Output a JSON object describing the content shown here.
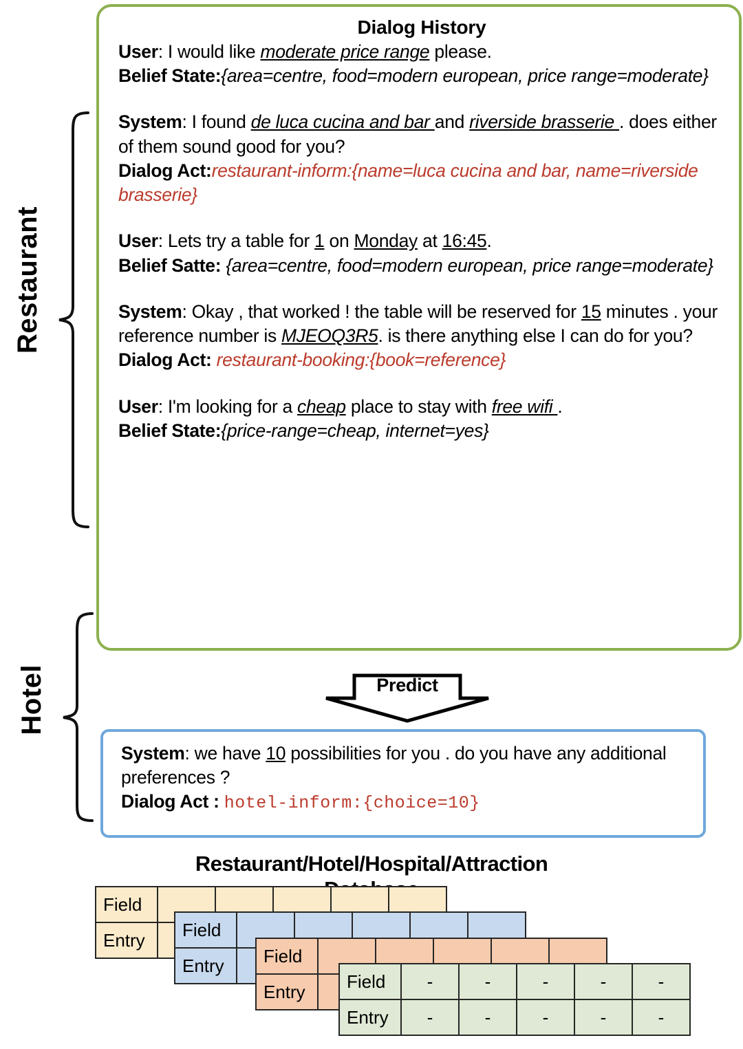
{
  "side_labels": {
    "restaurant": "Restaurant",
    "hotel": "Hotel"
  },
  "dialog_history": {
    "title": "Dialog History",
    "turns": [
      {
        "speaker": "User",
        "text_parts": [
          {
            "t": ": I would like ",
            "style": "plain"
          },
          {
            "t": "moderate price range",
            "style": "italic-underline"
          },
          {
            "t": " please.",
            "style": "plain"
          }
        ],
        "annotation_label": "Belief State",
        "annotation_sep": ":",
        "annotation_value": "{area=centre, food=modern european, price range=moderate}",
        "annotation_style": "italic"
      },
      {
        "speaker": "System",
        "text_parts": [
          {
            "t": ": I found ",
            "style": "plain"
          },
          {
            "t": "de luca cucina and bar ",
            "style": "italic-underline"
          },
          {
            "t": "and ",
            "style": "plain"
          },
          {
            "t": "riverside brasserie ",
            "style": "italic-underline"
          },
          {
            "t": ". does either of them sound good for you?",
            "style": "plain"
          }
        ],
        "annotation_label": "Dialog Act",
        "annotation_sep": ":",
        "annotation_value": "restaurant-inform:{name=luca cucina and bar, name=riverside brasserie}",
        "annotation_style": "red-italic"
      },
      {
        "speaker": "User",
        "text_parts": [
          {
            "t": ": Lets try a table for ",
            "style": "plain"
          },
          {
            "t": "1",
            "style": "underline"
          },
          {
            "t": " on ",
            "style": "plain"
          },
          {
            "t": "Monday",
            "style": "underline"
          },
          {
            "t": " at ",
            "style": "plain"
          },
          {
            "t": "16:45",
            "style": "underline"
          },
          {
            "t": ".",
            "style": "plain"
          }
        ],
        "annotation_label": "Belief Satte",
        "annotation_sep": ": ",
        "annotation_value": "{area=centre, food=modern european, price range=moderate}",
        "annotation_style": "italic"
      },
      {
        "speaker": "System",
        "text_parts": [
          {
            "t": ": Okay , that worked ! the table will be reserved for ",
            "style": "plain"
          },
          {
            "t": "15",
            "style": "underline"
          },
          {
            "t": " minutes . your reference number is ",
            "style": "plain"
          },
          {
            "t": "MJEOQ3R5",
            "style": "italic-underline"
          },
          {
            "t": ". is there anything else I can do for you?",
            "style": "plain"
          }
        ],
        "annotation_label": "Dialog Act",
        "annotation_sep": ": ",
        "annotation_value": "restaurant-booking:{book=reference}",
        "annotation_style": "red-italic"
      },
      {
        "speaker": "User",
        "text_parts": [
          {
            "t": ":  I'm looking for a ",
            "style": "plain"
          },
          {
            "t": "cheap",
            "style": "italic-underline"
          },
          {
            "t": " place to stay with ",
            "style": "plain"
          },
          {
            "t": "free wifi ",
            "style": "italic-underline"
          },
          {
            "t": ".",
            "style": "plain"
          }
        ],
        "annotation_label": "Belief State",
        "annotation_sep": ":",
        "annotation_value": "{price-range=cheap, internet=yes}",
        "annotation_style": "italic"
      }
    ]
  },
  "predict_arrow": {
    "label": "Predict"
  },
  "prediction_box": {
    "speaker": "System",
    "text_parts": [
      {
        "t": ": we have ",
        "style": "plain"
      },
      {
        "t": "10",
        "style": "underline"
      },
      {
        "t": " possibilities for you . do you have any additional preferences ?",
        "style": "plain"
      }
    ],
    "annotation_label": "Dialog Act",
    "annotation_sep": " : ",
    "annotation_value": "hotel-inform:{choice=10}",
    "annotation_style": "mono-red"
  },
  "database": {
    "title": "Restaurant/Hotel/Hospital/Attraction",
    "subtitle": "Database",
    "tables": [
      {
        "id": "restaurant-db-table",
        "color": "#FBEBCB",
        "rows": [
          [
            "Field",
            "",
            "",
            "",
            "",
            ""
          ],
          [
            "Entry",
            "",
            "",
            "",
            "",
            ""
          ]
        ]
      },
      {
        "id": "hotel-db-table",
        "color": "#C7D9EE",
        "rows": [
          [
            "Field",
            "",
            "",
            "",
            "",
            ""
          ],
          [
            "Entry",
            "",
            "",
            "",
            "",
            ""
          ]
        ]
      },
      {
        "id": "hospital-db-table",
        "color": "#F7CCAE",
        "rows": [
          [
            "Field",
            "",
            "",
            "",
            "",
            ""
          ],
          [
            "Entry",
            "",
            "",
            "",
            "",
            ""
          ]
        ]
      },
      {
        "id": "attraction-db-table",
        "color": "#DFE9D5",
        "rows": [
          [
            "Field",
            "-",
            "-",
            "-",
            "-",
            "-"
          ],
          [
            "Entry",
            "-",
            "-",
            "-",
            "-",
            "-"
          ]
        ]
      }
    ]
  },
  "colors": {
    "dialog_border": "#8CB04F",
    "predict_border": "#6FA8DC",
    "accent_red": "#BB3B2C",
    "table_cream": "#FBEBCB",
    "table_blue": "#C7D9EE",
    "table_orange": "#F7CCAE",
    "table_green": "#DFE9D5"
  }
}
